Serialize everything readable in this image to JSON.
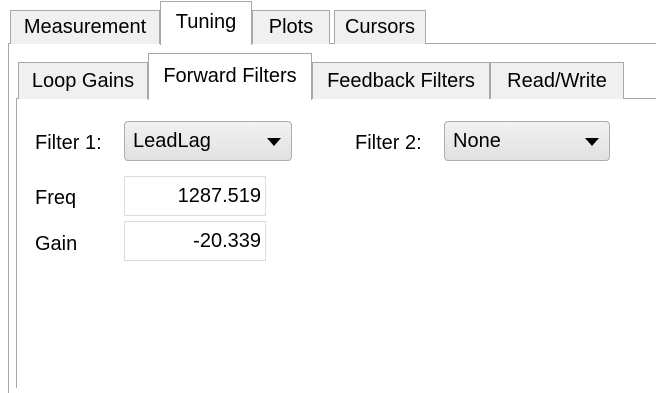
{
  "outer_tabs": [
    {
      "label": "Measurement",
      "active": false
    },
    {
      "label": "Tuning",
      "active": true
    },
    {
      "label": "Plots",
      "active": false
    },
    {
      "label": "Cursors",
      "active": false
    }
  ],
  "inner_tabs": [
    {
      "label": "Loop Gains",
      "active": false
    },
    {
      "label": "Forward Filters",
      "active": true
    },
    {
      "label": "Feedback Filters",
      "active": false
    },
    {
      "label": "Read/Write",
      "active": false
    }
  ],
  "filter1": {
    "label": "Filter 1:",
    "value": "LeadLag"
  },
  "filter2": {
    "label": "Filter 2:",
    "value": "None"
  },
  "freq": {
    "label": "Freq",
    "value": "1287.519"
  },
  "gain": {
    "label": "Gain",
    "value": "-20.339"
  },
  "icons": {
    "dropdown": "chevron-down-icon"
  }
}
